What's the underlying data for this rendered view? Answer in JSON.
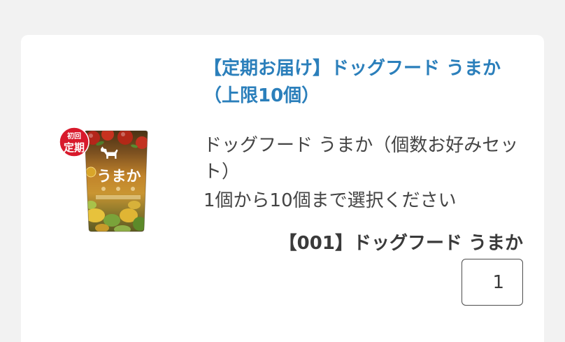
{
  "product": {
    "title": "【定期お届け】ドッグフード うまか（上限10個）",
    "description": "ドッグフード うまか（個数お好みセット）",
    "note": "1個から10個まで選択ください",
    "image": {
      "badge_top": "初回",
      "badge_bottom": "定期",
      "package_label": "うまか"
    }
  },
  "variant": {
    "label": "【001】ドッグフード うまか",
    "quantity": "1"
  },
  "colors": {
    "page_background": "#f2f2f2",
    "title_link": "#2b7fbb",
    "badge": "#d8192b"
  }
}
